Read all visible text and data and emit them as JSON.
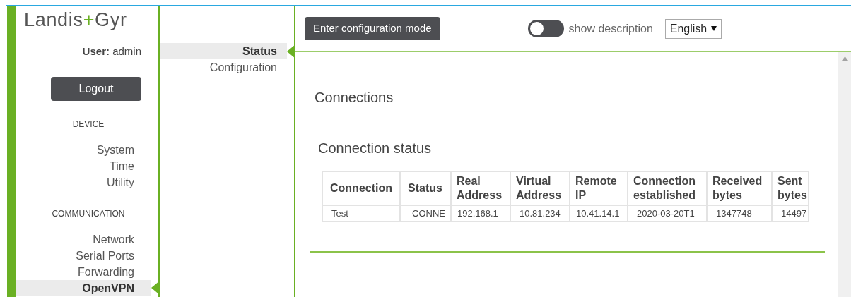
{
  "logo": {
    "left": "Landis",
    "plus": "+",
    "right": "Gyr"
  },
  "user": {
    "label": "User:",
    "name": "admin"
  },
  "logout": "Logout",
  "sidebar": {
    "sections": [
      {
        "title": "DEVICE",
        "items": [
          {
            "label": "System",
            "selected": false
          },
          {
            "label": "Time",
            "selected": false
          },
          {
            "label": "Utility",
            "selected": false
          }
        ]
      },
      {
        "title": "COMMUNICATION",
        "items": [
          {
            "label": "Network",
            "selected": false
          },
          {
            "label": "Serial Ports",
            "selected": false
          },
          {
            "label": "Forwarding",
            "selected": false
          },
          {
            "label": "OpenVPN",
            "selected": true
          }
        ]
      }
    ]
  },
  "subnav": [
    {
      "label": "Status",
      "selected": true
    },
    {
      "label": "Configuration",
      "selected": false
    }
  ],
  "toolbar": {
    "config_button": "Enter configuration mode",
    "description_toggle": {
      "label": "show description",
      "on": false
    },
    "language": "English"
  },
  "page_title": "Connections",
  "section_title": "Connection status",
  "table": {
    "columns": [
      "Connection",
      "Status",
      "Real Address",
      "Virtual Address",
      "Remote IP",
      "Connection established",
      "Received bytes",
      "Sent bytes"
    ],
    "rows": [
      [
        "Test",
        "CONNE",
        "192.168.1",
        "10.81.234",
        "10.41.14.1",
        "2020-03-20T1",
        "1347748",
        "14497"
      ]
    ]
  }
}
